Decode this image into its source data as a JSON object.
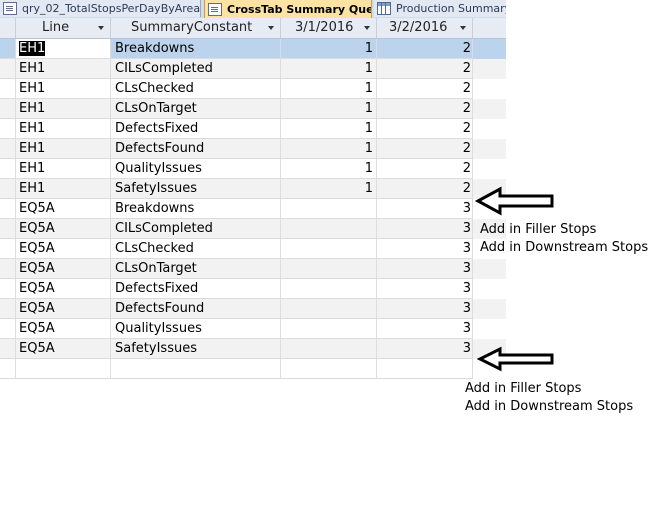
{
  "tabs": [
    {
      "label": "qry_02_TotalStopsPerDayByArea",
      "icon": "query-icon",
      "active": false
    },
    {
      "label": "CrossTab Summary Query",
      "icon": "query-icon",
      "active": true
    },
    {
      "label": "Production Summary",
      "icon": "table-icon",
      "active": false
    }
  ],
  "grid": {
    "headers": [
      "Line",
      "SummaryConstant",
      "3/1/2016",
      "3/2/2016"
    ],
    "rows": [
      [
        "EH1",
        "Breakdowns",
        "1",
        "2"
      ],
      [
        "EH1",
        "CILsCompleted",
        "1",
        "2"
      ],
      [
        "EH1",
        "CLsChecked",
        "1",
        "2"
      ],
      [
        "EH1",
        "CLsOnTarget",
        "1",
        "2"
      ],
      [
        "EH1",
        "DefectsFixed",
        "1",
        "2"
      ],
      [
        "EH1",
        "DefectsFound",
        "1",
        "2"
      ],
      [
        "EH1",
        "QualityIssues",
        "1",
        "2"
      ],
      [
        "EH1",
        "SafetyIssues",
        "1",
        "2"
      ],
      [
        "EQ5A",
        "Breakdowns",
        "",
        "3"
      ],
      [
        "EQ5A",
        "CILsCompleted",
        "",
        "3"
      ],
      [
        "EQ5A",
        "CLsChecked",
        "",
        "3"
      ],
      [
        "EQ5A",
        "CLsOnTarget",
        "",
        "3"
      ],
      [
        "EQ5A",
        "DefectsFixed",
        "",
        "3"
      ],
      [
        "EQ5A",
        "DefectsFound",
        "",
        "3"
      ],
      [
        "EQ5A",
        "QualityIssues",
        "",
        "3"
      ],
      [
        "EQ5A",
        "SafetyIssues",
        "",
        "3"
      ]
    ]
  },
  "annotations": {
    "note1": [
      "Add in Filler Stops",
      "Add in Downstream Stops"
    ],
    "note2": [
      "Add in Filler Stops",
      "Add in Downstream Stops"
    ]
  },
  "colors": {
    "active_tab": "#fbe3a3",
    "header_bg": "#e7ecf4",
    "selected_row": "#bcd3ee",
    "alt_row": "#f2f2f2"
  }
}
